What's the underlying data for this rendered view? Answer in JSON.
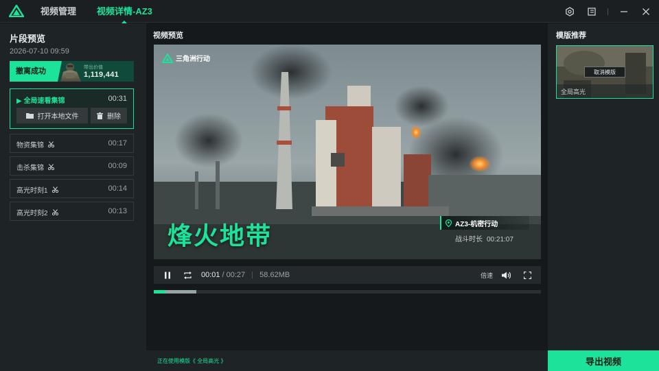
{
  "titlebar": {
    "tabs": [
      {
        "label": "视频管理"
      },
      {
        "label": "视频详情-AZ3"
      }
    ]
  },
  "left": {
    "title": "片段预览",
    "date": "2026-07-10 09:59",
    "result": {
      "badge": "撤离成功",
      "value_label": "带出价值",
      "value": "1,119,441"
    },
    "active_clip": {
      "title": "全局速看集锦",
      "duration": "00:31",
      "open_label": "打开本地文件",
      "delete_label": "删除"
    },
    "clips": [
      {
        "title": "物资集锦",
        "duration": "00:17"
      },
      {
        "title": "击杀集锦",
        "duration": "00:09"
      },
      {
        "title": "高光时刻1",
        "duration": "00:14"
      },
      {
        "title": "高光时刻2",
        "duration": "00:13"
      }
    ]
  },
  "preview": {
    "title": "视频预览",
    "watermark": "三角洲行动",
    "big_title": "烽火地带",
    "operation": "AZ3-机密行动",
    "battle_label": "战斗时长",
    "battle_time": "00:21:07",
    "current_time": "00:01",
    "total_time": "/ 00:27",
    "file_size": "58.62MB",
    "speed_label": "倍速",
    "progress_played": 0.03,
    "progress_buffered": 0.11
  },
  "footer": {
    "text": "正在使用模版《 全局高光 》"
  },
  "right": {
    "title": "模版推荐",
    "template": {
      "cancel_label": "取消模版",
      "name": "全局高光"
    },
    "export_label": "导出视频"
  },
  "colors": {
    "accent": "#1de29a",
    "panel": "#1e2426",
    "background": "#15191b"
  }
}
